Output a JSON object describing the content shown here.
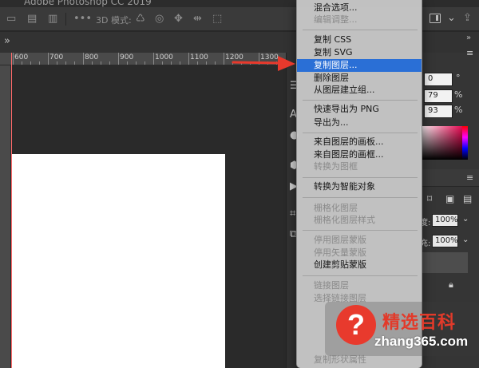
{
  "app": {
    "window_title": "Adobe Photoshop CC 2019",
    "accent_color": "#2a6fd6"
  },
  "options_bar": {
    "mode_label": "3D 模式:"
  },
  "ruler": {
    "ticks": [
      "600",
      "700",
      "800",
      "900",
      "1000",
      "1100",
      "1200",
      "1300"
    ]
  },
  "properties_panel": {
    "angle_value": "0",
    "angle_unit": "°",
    "opacity_a_value": "79",
    "opacity_b_value": "93",
    "percent_unit": "%",
    "opacity_label": "度:",
    "opacity_value": "100%",
    "fill_label": "充:",
    "fill_value": "100%"
  },
  "context_menu": {
    "items": [
      {
        "label": "混合选项...",
        "disabled": false,
        "highlighted": false
      },
      {
        "label": "编辑调整...",
        "disabled": true,
        "highlighted": false
      },
      {
        "label": "复制 CSS",
        "disabled": false,
        "highlighted": false
      },
      {
        "label": "复制 SVG",
        "disabled": false,
        "highlighted": false
      },
      {
        "label": "复制图层...",
        "disabled": false,
        "highlighted": true
      },
      {
        "label": "删除图层",
        "disabled": false,
        "highlighted": false
      },
      {
        "label": "从图层建立组...",
        "disabled": false,
        "highlighted": false
      },
      {
        "label": "快速导出为 PNG",
        "disabled": false,
        "highlighted": false
      },
      {
        "label": "导出为...",
        "disabled": false,
        "highlighted": false
      },
      {
        "label": "来自图层的画板...",
        "disabled": false,
        "highlighted": false
      },
      {
        "label": "来自图层的画框...",
        "disabled": false,
        "highlighted": false
      },
      {
        "label": "转换为图框",
        "disabled": true,
        "highlighted": false
      },
      {
        "label": "转换为智能对象",
        "disabled": false,
        "highlighted": false
      },
      {
        "label": "栅格化图层",
        "disabled": true,
        "highlighted": false
      },
      {
        "label": "栅格化图层样式",
        "disabled": true,
        "highlighted": false
      },
      {
        "label": "停用图层蒙版",
        "disabled": true,
        "highlighted": false
      },
      {
        "label": "停用矢量蒙版",
        "disabled": true,
        "highlighted": false
      },
      {
        "label": "创建剪贴蒙版",
        "disabled": false,
        "highlighted": false
      },
      {
        "label": "链接图层",
        "disabled": true,
        "highlighted": false
      },
      {
        "label": "选择链接图层",
        "disabled": true,
        "highlighted": false
      },
      {
        "label": "复制形状属性",
        "disabled": true,
        "highlighted": false
      }
    ]
  },
  "watermark": {
    "brand": "精选百科",
    "site": "zhang365.com",
    "qmark": "?"
  }
}
